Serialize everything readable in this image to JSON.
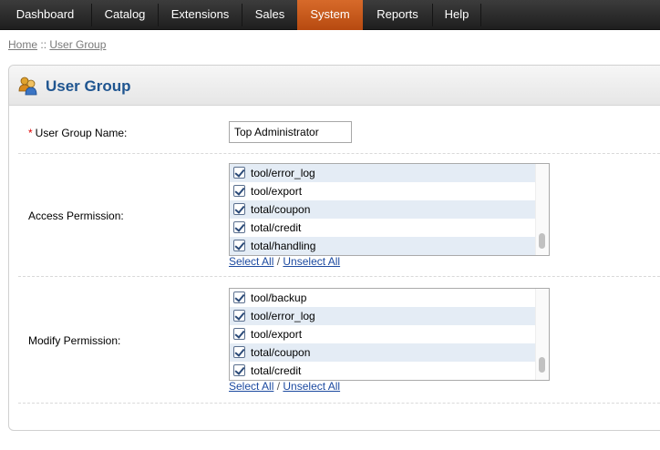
{
  "menu": {
    "items": [
      {
        "label": "Dashboard"
      },
      {
        "label": "Catalog"
      },
      {
        "label": "Extensions"
      },
      {
        "label": "Sales"
      },
      {
        "label": "System"
      },
      {
        "label": "Reports"
      },
      {
        "label": "Help"
      }
    ],
    "active": "System",
    "active_color": "#c55a1c"
  },
  "breadcrumb": {
    "home": "Home",
    "separator": "::",
    "current": "User Group"
  },
  "heading": {
    "title": "User Group",
    "icon": "users-icon",
    "title_color": "#1f5590"
  },
  "form": {
    "name_required_marker": "*",
    "name_label": "User Group Name:",
    "name_value": "Top Administrator",
    "access_label": "Access Permission:",
    "access_items": [
      {
        "label": "tool/error_log",
        "checked": true
      },
      {
        "label": "tool/export",
        "checked": true
      },
      {
        "label": "total/coupon",
        "checked": true
      },
      {
        "label": "total/credit",
        "checked": true
      },
      {
        "label": "total/handling",
        "checked": true
      }
    ],
    "modify_label": "Modify Permission:",
    "modify_items": [
      {
        "label": "tool/backup",
        "checked": true
      },
      {
        "label": "tool/error_log",
        "checked": true
      },
      {
        "label": "tool/export",
        "checked": true
      },
      {
        "label": "total/coupon",
        "checked": true
      },
      {
        "label": "total/credit",
        "checked": true
      }
    ],
    "select_all": "Select All",
    "link_separator": "/",
    "unselect_all": "Unselect All"
  }
}
